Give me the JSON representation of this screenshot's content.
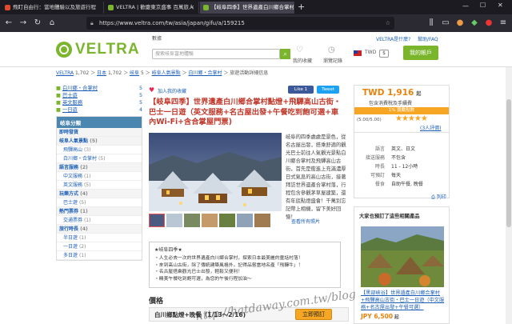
{
  "browser": {
    "tabs": [
      {
        "label": "飛盯自由行：當地體驗以及旅遊行程"
      },
      {
        "label": "VELTRA | 歡慶東京盛事 百萬旅人"
      },
      {
        "label": "【岐阜四季】世界遺產白川鄉合掌村"
      }
    ],
    "url": "https://www.veltra.com/tw/asia/japan/gifu/a/159215"
  },
  "header": {
    "logo_text": "VELTRA",
    "search_label": "數據",
    "search_placeholder": "搜索岐阜當地體驗",
    "links": [
      "VELTRA是什麼?",
      "幫助/FAQ"
    ],
    "coupon_label": "我的收藏",
    "recent_label": "瀏覽記錄",
    "currency": "TWD",
    "account_button": "我的帳戶"
  },
  "breadcrumb": [
    "VELTRA",
    "1,702",
    "日本",
    "1,702",
    "岐阜",
    "5",
    "岐阜人氣景點",
    "白川鄉・合掌村",
    "旅遊活動詳細信息"
  ],
  "sidebar": {
    "top_links": [
      {
        "label": "白川鄉・合掌村",
        "count": "5"
      },
      {
        "label": "巴士遊",
        "count": "5"
      },
      {
        "label": "英文服務",
        "count": "5"
      },
      {
        "label": "一日遊",
        "count": "4"
      }
    ],
    "category_title": "岐阜分類",
    "rows": [
      {
        "label": "即時發貨",
        "count": "",
        "kind": "head"
      },
      {
        "label": "岐阜人氣景點",
        "count": "(5)",
        "kind": "head"
      },
      {
        "label": "飛驒高山",
        "count": "(3)",
        "kind": "sub"
      },
      {
        "label": "白川鄉・合掌村",
        "count": "(5)",
        "kind": "sub"
      },
      {
        "label": "語言服務",
        "count": "(2)",
        "kind": "head"
      },
      {
        "label": "中文服務",
        "count": "(1)",
        "kind": "sub"
      },
      {
        "label": "英文服務",
        "count": "(5)",
        "kind": "sub"
      },
      {
        "label": "玩樂方式",
        "count": "(4)",
        "kind": "head"
      },
      {
        "label": "巴士遊",
        "count": "(5)",
        "kind": "sub"
      },
      {
        "label": "熱門票券",
        "count": "(1)",
        "kind": "head"
      },
      {
        "label": "交通票券",
        "count": "(1)",
        "kind": "sub"
      },
      {
        "label": "旅行時長",
        "count": "(4)",
        "kind": "head"
      },
      {
        "label": "半日遊",
        "count": "(1)",
        "kind": "sub"
      },
      {
        "label": "一日遊",
        "count": "(2)",
        "kind": "sub"
      },
      {
        "label": "多日遊",
        "count": "(1)",
        "kind": "sub"
      }
    ]
  },
  "main": {
    "favorite_label": "加入我的收藏",
    "like_label": "Like 1",
    "tweet_label": "Tweet",
    "title": "【岐阜四季】世界遺產白川鄉合掌村點燈+飛驒高山古街・巴士一日遊（英文服務+名古屋出發+午餐吃到飽可選+車內Wi-Fi+含合掌屋門票)",
    "description": "岐阜的四季處處是景色，從名古屋出發，搭乘舒適的觀光巴士前往人氣觀光景點白川鄉合掌村及飛驒高山古街，首先是衝進上充滿濃厚日式氣息的高山古街，接著拜訪世界遺產合掌村落，行程包含參觀茅草屋建築，還有年底點燈盛會！千萬別忘記帶上相機，留下美好回憶！",
    "more_photos": "查看所有照片",
    "highlight_title": "★岐阜四季★",
    "highlights": [
      "・人生必去一次的世界遺產白川鄉合掌村，探索日本最美麗的童話村落！",
      "・來到高山古街，除了傳統建築風格外，記得品嘗當地名產「飛驒牛」！",
      "・名古屋搭乘觀光巴士出發，輕鬆又便利！",
      "・精美午餐吃到飽可選，為您的午後行程加油～"
    ],
    "price_heading": "價格",
    "plan_label": "白川鄉點燈+晚餐（1/13～2/16)",
    "book_button": "立即預訂"
  },
  "right": {
    "price": "TWD 1,916",
    "price_suffix": "起",
    "tax_note": "包含消費稅及手續費",
    "points_badge": "1% 獎勵點數",
    "rating_text": "(5.00/5.00)",
    "rating_value": 5,
    "reviews_link": "(3人評價)",
    "info": [
      {
        "key": "語言",
        "value": "英文、日文"
      },
      {
        "key": "接送服務",
        "value": "不包含"
      },
      {
        "key": "時長",
        "value": "11 - 12小時"
      },
      {
        "key": "可預訂",
        "value": "每天"
      },
      {
        "key": "餐食",
        "value": "自助午餐, 晚餐"
      }
    ],
    "print_label": "列印",
    "reco_title": "大家也預訂了這些相關產品",
    "reco_item_title": "【黑部峽谷】世界遺產白川鄉合掌村+飛驒高山古街・巴士一日遊（中文服務+名古屋出發+午餐可選）",
    "reco_price": "JPY 6,500",
    "reco_price_suffix": "起"
  },
  "watermark": "http://hatdaway.com.tw/blog",
  "colors": {
    "brand_green": "#7ab52c",
    "title_red": "#c0392b",
    "link_blue": "#1a5eb8",
    "price_orange": "#e8820c",
    "side_header": "#4a86b0"
  }
}
